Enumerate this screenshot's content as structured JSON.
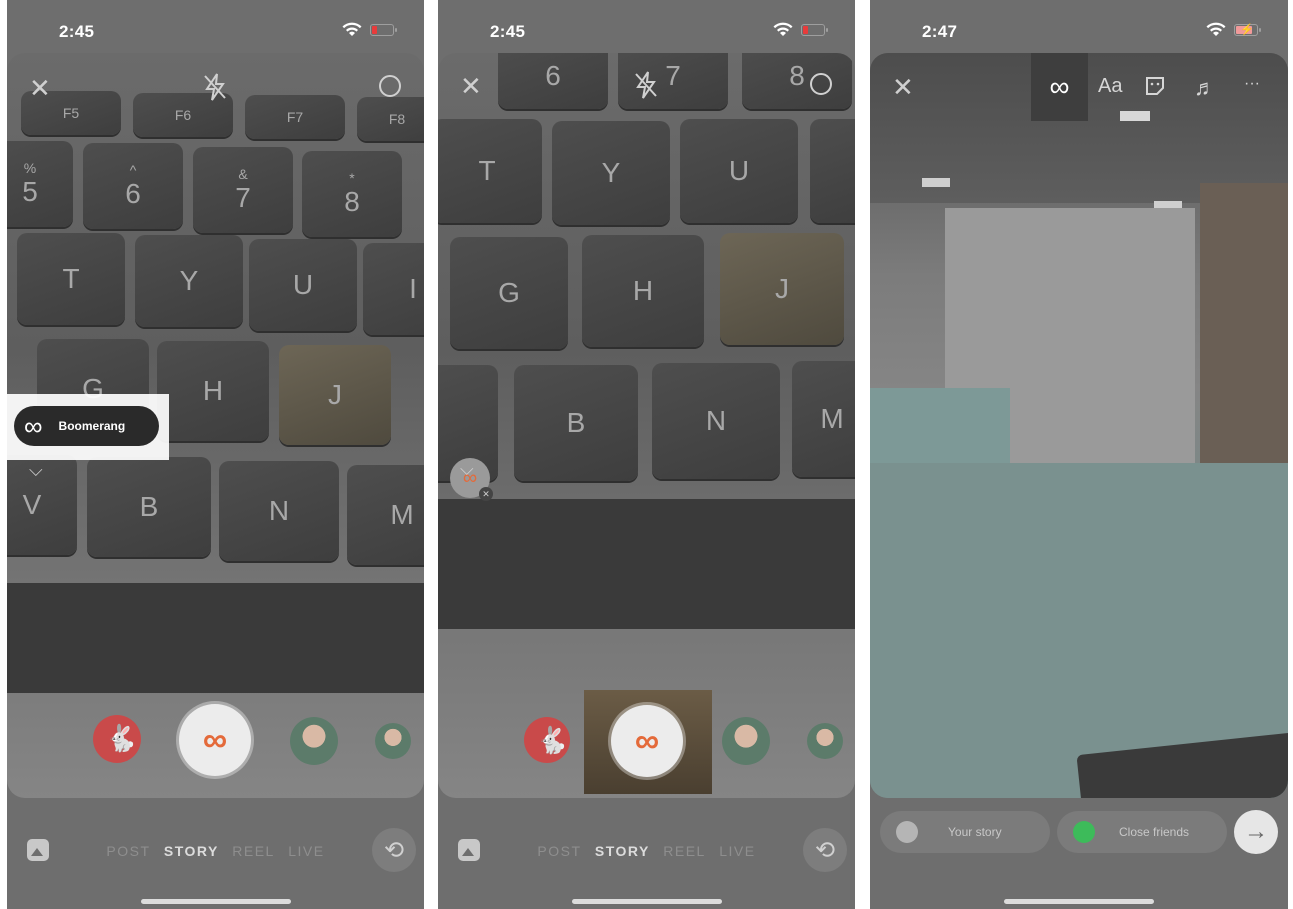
{
  "panel1": {
    "time": "2:45",
    "boomerang_label": "Boomerang",
    "keys": {
      "f5": "F5",
      "f6": "F6",
      "f7": "F7",
      "f8": "F8",
      "k5": "5",
      "k5_top": "%",
      "k6": "6",
      "k6_top": "^",
      "k7": "7",
      "k7_top": "&",
      "k8": "8",
      "k8_top": "*",
      "t": "T",
      "y": "Y",
      "u": "U",
      "i": "I",
      "g": "G",
      "h": "H",
      "j": "J",
      "v": "V",
      "b": "B",
      "n": "N",
      "m": "M"
    },
    "modes": [
      "POST",
      "STORY",
      "REEL",
      "LIVE"
    ],
    "active_mode": "STORY"
  },
  "panel2": {
    "time": "2:45",
    "keys": {
      "k6": "6",
      "k7": "7",
      "k8": "8",
      "t": "T",
      "y": "Y",
      "u": "U",
      "g": "G",
      "h": "H",
      "j": "J",
      "b": "B",
      "n": "N",
      "m": "M"
    },
    "modes": [
      "POST",
      "STORY",
      "REEL",
      "LIVE"
    ],
    "active_mode": "STORY"
  },
  "panel3": {
    "time": "2:47",
    "text_tool": "Aa",
    "more": "···",
    "your_story": "Your story",
    "close_friends": "Close friends"
  },
  "icons": {
    "close": "close-icon",
    "flash": "flash-off-icon",
    "settings": "settings-icon",
    "boomerang": "infinity-icon",
    "flip": "flip-camera-icon",
    "gallery": "gallery-icon",
    "sticker": "sticker-icon",
    "music": "music-icon",
    "next": "arrow-right-icon"
  },
  "colors": {
    "boomerang_gradient_start": "#f2a23a",
    "boomerang_gradient_end": "#c23fd0",
    "close_friends_green": "#3dbb5a",
    "battery_low": "#e83b3b"
  }
}
